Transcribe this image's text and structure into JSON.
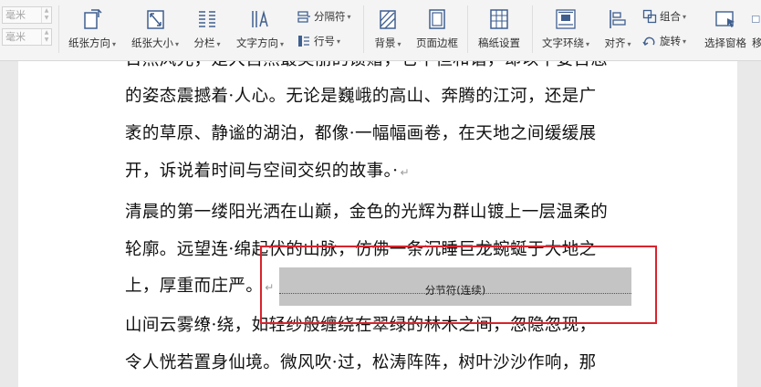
{
  "ribbon": {
    "unit_top": "毫米",
    "unit_bottom": "毫米",
    "paper_direction": "纸张方向",
    "paper_size": "纸张大小",
    "columns": "分栏",
    "text_direction": "文字方向",
    "separator": "分隔符",
    "line_number": "行号",
    "background": "背景",
    "page_border": "页面边框",
    "manuscript": "稿纸设置",
    "text_wrap": "文字环绕",
    "align": "对齐",
    "group": "组合",
    "rotate": "旋转",
    "selection_pane": "选择窗格",
    "more": "移"
  },
  "document": {
    "lines": [
      "日照风光，是大自然最美丽的馈赠，它不但和谐，却以千姿百态",
      "的姿态震撼着·人心。无论是巍峨的高山、奔腾的江河，还是广",
      "袤的草原、静谧的湖泊，都像·一幅幅画卷，在天地之间缓缓展",
      "开，诉说着时间与空间交织的故事。·",
      "清晨的第一缕阳光洒在山巅，金色的光辉为群山镀上一层温柔的",
      "轮廓。远望连·绵起伏的山脉，仿佛一条沉睡巨龙蜿蜒于大地之",
      "上，厚重而庄严。",
      "山间云雾缭·绕，如轻纱般缠绕在翠绿的林木之间，忽隐忽现，",
      "令人恍若置身仙境。微风吹·过，松涛阵阵，树叶沙沙作响，那"
    ],
    "paragraph_mark": "↵",
    "section_break_label": "分节符(连续)"
  },
  "colors": {
    "highlight": "#d9232d",
    "section_break_bg": "#c4c4c4"
  }
}
